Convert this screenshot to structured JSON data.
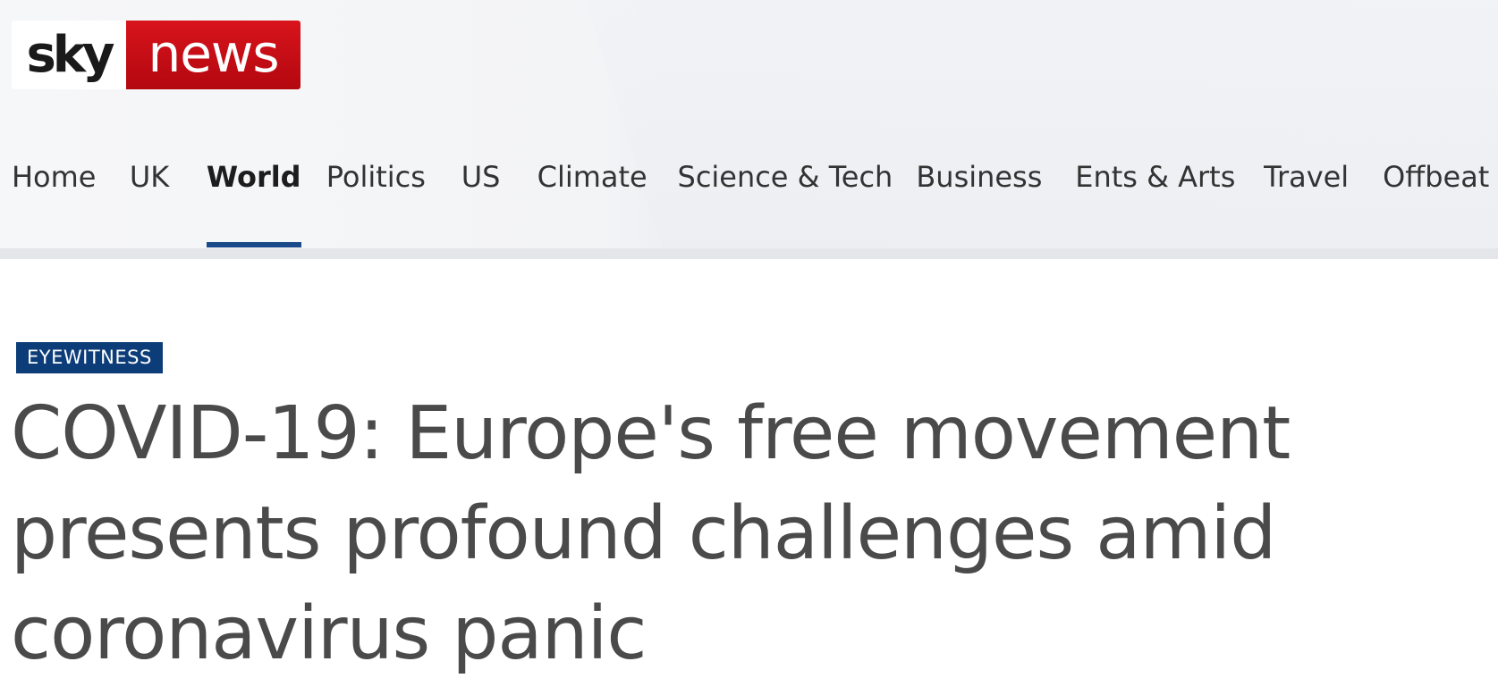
{
  "brand": {
    "logo_left": "sky",
    "logo_right": "news",
    "accent_color": "#c80a12"
  },
  "nav": {
    "items": [
      {
        "label": "Home"
      },
      {
        "label": "UK"
      },
      {
        "label": "World",
        "active": true
      },
      {
        "label": "Politics"
      },
      {
        "label": "US"
      },
      {
        "label": "Climate"
      },
      {
        "label": "Science & Tech"
      },
      {
        "label": "Business"
      },
      {
        "label": "Ents & Arts"
      },
      {
        "label": "Travel"
      },
      {
        "label": "Offbeat"
      }
    ],
    "active_color": "#1a4a8a"
  },
  "article": {
    "label": "EYEWITNESS",
    "label_color": "#0d3d79",
    "headline": "COVID-19: Europe's free movement presents profound challenges amid coronavirus panic"
  }
}
